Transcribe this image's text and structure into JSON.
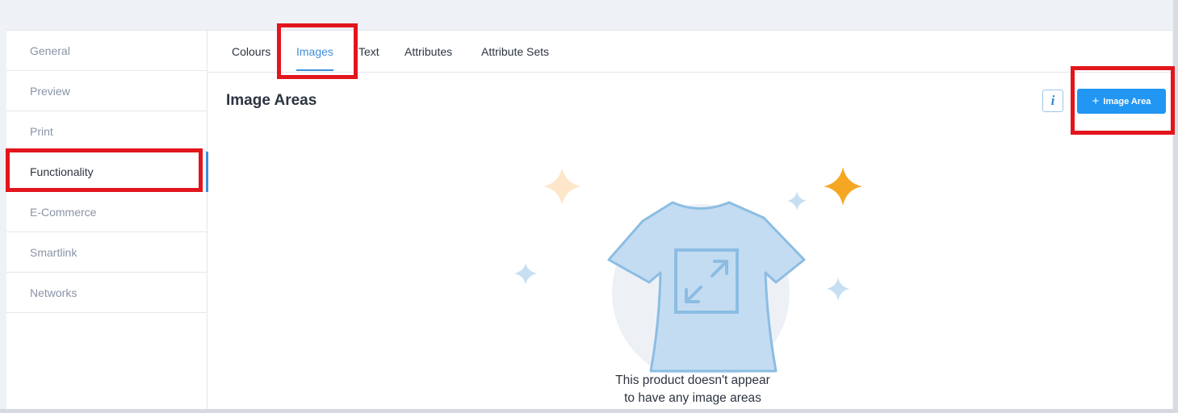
{
  "sidebar": {
    "items": [
      {
        "label": "General"
      },
      {
        "label": "Preview"
      },
      {
        "label": "Print"
      },
      {
        "label": "Functionality"
      },
      {
        "label": "E-Commerce"
      },
      {
        "label": "Smartlink"
      },
      {
        "label": "Networks"
      }
    ],
    "active": "Functionality"
  },
  "tabs": {
    "items": [
      {
        "label": "Colours"
      },
      {
        "label": "Images"
      },
      {
        "label": "Text"
      },
      {
        "label": "Attributes"
      },
      {
        "label": "Attribute Sets"
      }
    ],
    "active": "Images"
  },
  "main": {
    "title": "Image Areas",
    "info_icon": "info-icon",
    "add_button": {
      "icon": "plus-icon",
      "label": "Image Area"
    },
    "empty_state": {
      "illustration": "t-shirt-resize-icon",
      "line1": "This product doesn't appear",
      "line2": "to have any image areas"
    }
  },
  "colors": {
    "accent": "#3f8ed8",
    "primary_button": "#2196f3",
    "highlight": "#e3151d",
    "shirt": "#c3dcf1",
    "sparkle_orange": "#f5a623"
  }
}
